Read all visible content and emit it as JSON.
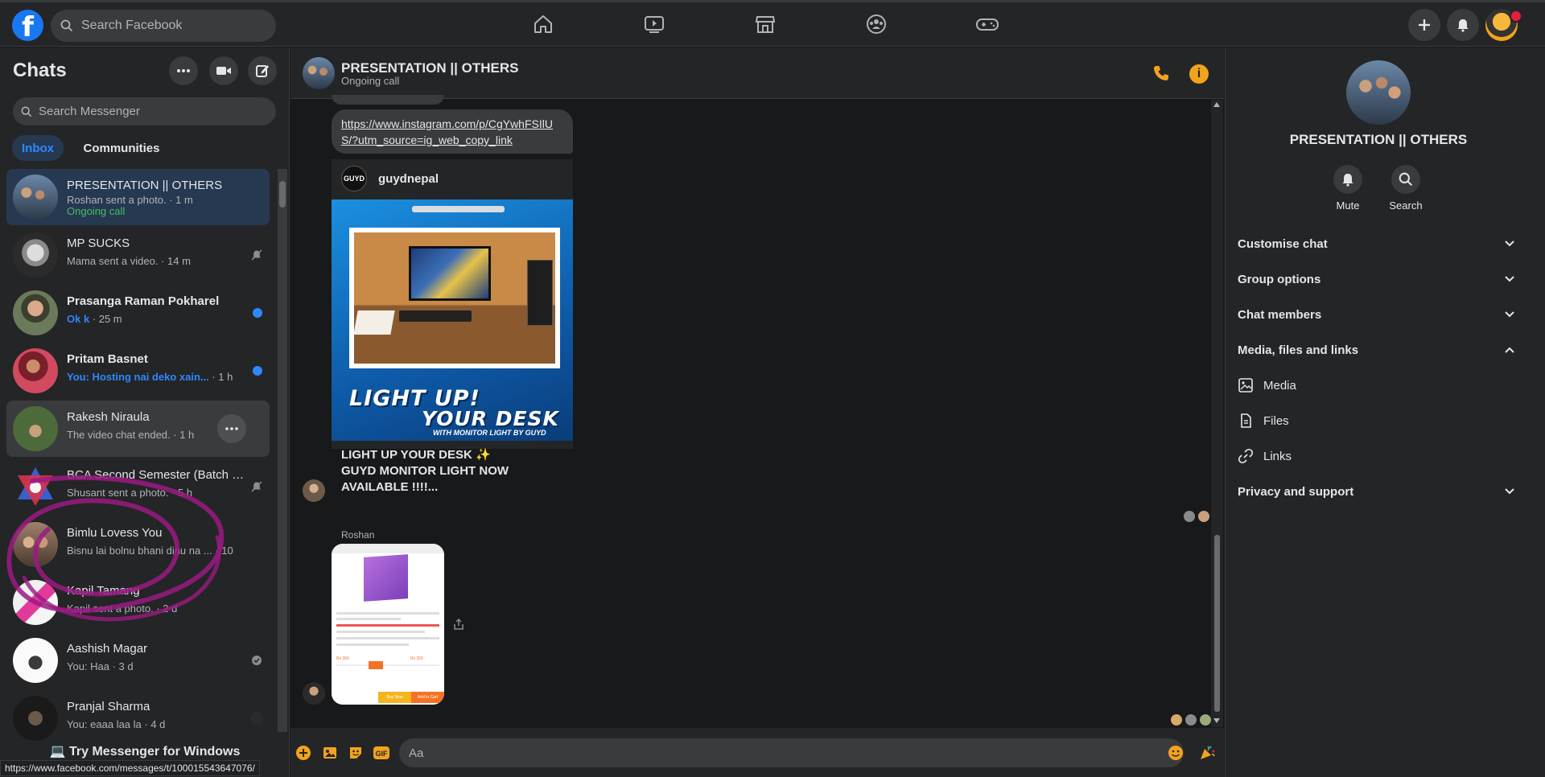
{
  "topbar": {
    "logo_letter": "f",
    "search_placeholder": "Search Facebook",
    "nav": [
      "home-icon",
      "watch-icon",
      "marketplace-icon",
      "groups-icon",
      "gaming-icon"
    ]
  },
  "sidebar": {
    "title": "Chats",
    "search_placeholder": "Search Messenger",
    "tabs": [
      {
        "label": "Inbox",
        "active": true
      },
      {
        "label": "Communities",
        "active": false
      }
    ],
    "chats": [
      {
        "name": "PRESENTATION || OTHERS",
        "preview": "Roshan sent a photo. · 1 m",
        "status": "Ongoing call",
        "active": true
      },
      {
        "name": "MP SUCKS",
        "preview": "Mama sent a video. · 14 m",
        "muted": true
      },
      {
        "name": "Prasanga Raman Pokharel",
        "preview_bold": "Ok k",
        "preview": " · 25 m",
        "unread": true
      },
      {
        "name": "Pritam Basnet",
        "preview_bold": "You: Hosting nai deko xain...",
        "preview": " · 1 h",
        "unread": true
      },
      {
        "name": "Rakesh Niraula",
        "preview": "The video chat ended. · 1 h",
        "hover": true
      },
      {
        "name": "BCA Second Semester (Batch 2...",
        "preview": "Shusant sent a photo. · 5 h",
        "muted": true
      },
      {
        "name": "Bimlu Lovess You",
        "preview": "Bisnu lai bolnu bhani dinu na ... · 10 h"
      },
      {
        "name": "Kapil Tamang",
        "preview": "Kapil sent a photo. · 2 d"
      },
      {
        "name": "Aashish Magar",
        "preview": "You: Haa · 3 d",
        "delivered": true
      },
      {
        "name": "Pranjal Sharma",
        "preview": "You: eaaa laa la · 4 d"
      }
    ],
    "footer": "Try Messenger for Windows"
  },
  "status_bar_url": "https://www.facebook.com/messages/t/100015543647076/",
  "conversation": {
    "name": "PRESENTATION || OTHERS",
    "status": "Ongoing call",
    "link": "https://www.instagram.com/p/CgYwhFSIlUS/?utm_source=ig_web_copy_link",
    "share_logo": "GUYD",
    "share_user": "guydnepal",
    "ad_title_1": "LIGHT UP!",
    "ad_title_2": "YOUR DESK",
    "ad_sub": "WITH MONITOR LIGHT BY GUYD",
    "ad_caption": "LIGHT UP YOUR DESK ✨\nGUYD MONITOR LIGHT NOW AVAILABLE !!!!...",
    "sender_label": "Roshan",
    "compose_placeholder": "Aa",
    "photo_price_1": "Rs 350",
    "photo_price_2": "Rs 350",
    "photo_buy": "Buy Now",
    "photo_cart": "Add to Cart"
  },
  "details": {
    "name": "PRESENTATION || OTHERS",
    "actions": [
      {
        "label": "Mute",
        "icon": "bell-icon"
      },
      {
        "label": "Search",
        "icon": "search-icon"
      }
    ],
    "sections": [
      {
        "label": "Customise chat",
        "expanded": false
      },
      {
        "label": "Group options",
        "expanded": false
      },
      {
        "label": "Chat members",
        "expanded": false
      },
      {
        "label": "Media, files and links",
        "expanded": true
      }
    ],
    "media_items": [
      "Media",
      "Files",
      "Links"
    ],
    "privacy": "Privacy and support"
  },
  "colors": {
    "accent": "#2d88ff",
    "call_orange": "#f2a31d",
    "online_green": "#45bd62",
    "bg_dark": "#18191a",
    "panel": "#242526"
  }
}
